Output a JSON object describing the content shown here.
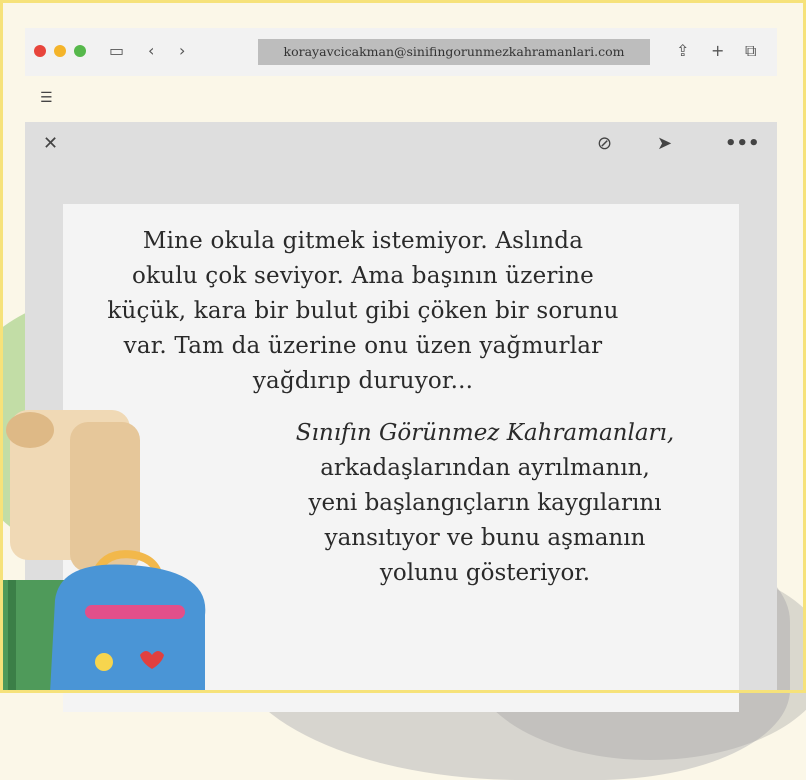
{
  "browser": {
    "url": "korayavcicakman@sinifingorunmezkahramanlari.com",
    "icons": [
      "sidebar-icon",
      "back-icon",
      "forward-icon",
      "share-icon",
      "new-tab-icon",
      "tabs-icon"
    ]
  },
  "compose": {
    "toolbar_icons": [
      "close-icon",
      "attachment-icon",
      "send-icon",
      "more-icon"
    ]
  },
  "message": {
    "paragraph1_lines": [
      "Mine okula gitmek istemiyor. Aslında",
      "okulu çok seviyor. Ama başının üzerine",
      "küçük, kara bir bulut gibi çöken bir sorunu",
      "var. Tam da üzerine onu üzen yağmurlar",
      "yağdırıp duruyor..."
    ],
    "paragraph2_title": "Sınıfın Görünmez Kahramanları,",
    "paragraph2_lines": [
      "arkadaşlarından ayrılmanın,",
      "yeni başlangıçların kaygılarını",
      "yansıtıyor ve bunu aşmanın",
      "yolunu gösteriyor."
    ]
  },
  "colors": {
    "window_red": "#e8453c",
    "window_yellow": "#f4b42a",
    "window_green": "#56b84b",
    "frame_yellow": "#f6e27a"
  }
}
